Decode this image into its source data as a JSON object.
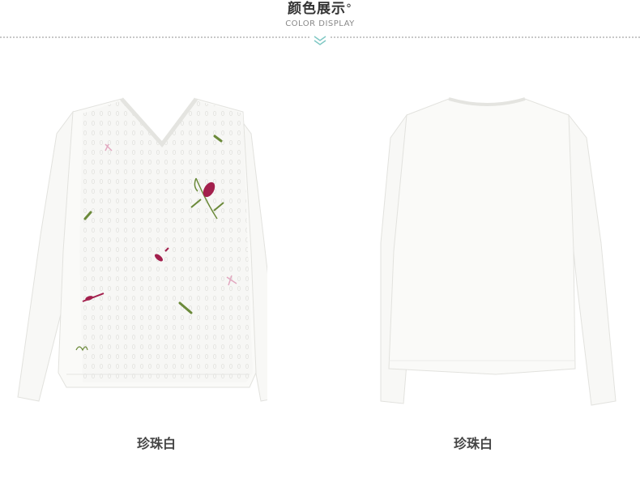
{
  "header": {
    "title": "颜色展示",
    "title_mark": "°",
    "subtitle": "COLOR DISPLAY",
    "accent_color": "#7fc8c4"
  },
  "products": [
    {
      "view": "front",
      "color_name": "珍珠白"
    },
    {
      "view": "back",
      "color_name": "珍珠白"
    }
  ]
}
